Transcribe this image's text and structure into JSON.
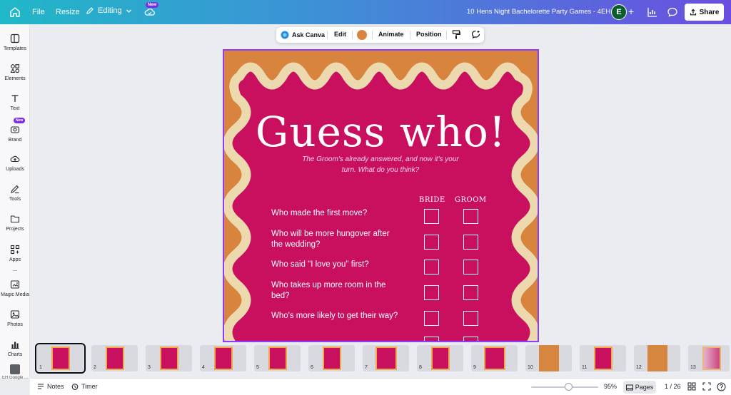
{
  "topbar": {
    "file_label": "File",
    "resize_label": "Resize",
    "editing_label": "Editing",
    "new_badge": "New",
    "doc_title": "10 Hens Night Bachelorette Party Games - 4EH",
    "avatar_initial": "E",
    "share_label": "Share"
  },
  "sidebar": {
    "items": [
      {
        "label": "Templates",
        "icon": "templates-icon"
      },
      {
        "label": "Elements",
        "icon": "elements-icon"
      },
      {
        "label": "Text",
        "icon": "text-icon"
      },
      {
        "label": "Brand",
        "icon": "brand-icon"
      },
      {
        "label": "Uploads",
        "icon": "uploads-icon"
      },
      {
        "label": "Tools",
        "icon": "tools-icon"
      },
      {
        "label": "Projects",
        "icon": "projects-icon"
      },
      {
        "label": "Apps",
        "icon": "apps-icon"
      },
      {
        "label": "Magic Media",
        "icon": "magic-media-icon"
      },
      {
        "label": "Photos",
        "icon": "photos-icon"
      },
      {
        "label": "Charts",
        "icon": "charts-icon"
      }
    ],
    "brand_new_badge": "New",
    "bottom_app_label": "EH Google ..."
  },
  "context_toolbar": {
    "ask_label": "Ask Canva",
    "edit_label": "Edit",
    "animate_label": "Animate",
    "position_label": "Position",
    "swatch_color": "#d88340"
  },
  "canvas": {
    "title": "Guess who!",
    "subtitle": "The Groom's already answered, and now it's your turn. What do you think?",
    "col_bride": "BRIDE",
    "col_groom": "GROOM",
    "questions": [
      "Who made the first move?",
      "Who will be more hungover after the wedding?",
      "Who said \"I love you\" first?",
      "Who takes up more room in the bed?",
      "Who's more likely to get their way?"
    ],
    "colors": {
      "background": "#d8843f",
      "panel": "#c8105f",
      "wave": "#ecd9ae"
    }
  },
  "pages_strip": {
    "pages": [
      "1",
      "2",
      "3",
      "4",
      "5",
      "6",
      "7",
      "8",
      "9",
      "10",
      "11",
      "12",
      "13"
    ],
    "active_page": "1"
  },
  "bottombar": {
    "notes_label": "Notes",
    "timer_label": "Timer",
    "zoom_label": "95%",
    "pages_label": "Pages",
    "page_count": "1 / 26"
  }
}
